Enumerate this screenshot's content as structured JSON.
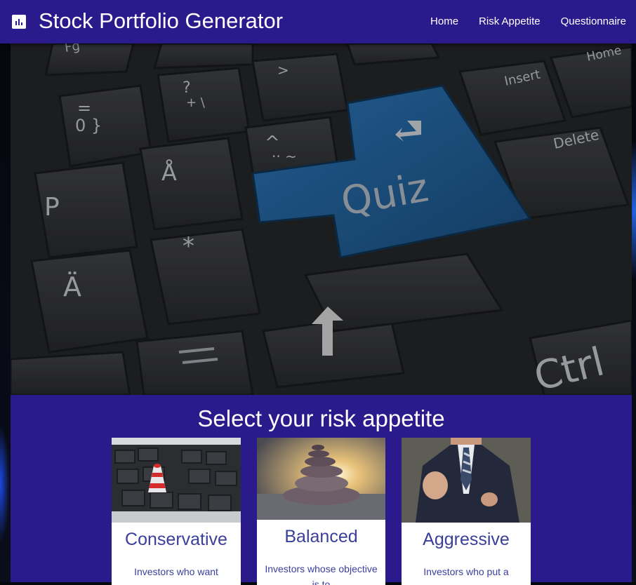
{
  "navbar": {
    "brand_icon": "bar-chart-icon",
    "title": "Stock Portfolio Generator",
    "links": [
      "Home",
      "Risk Appetite",
      "Questionnaire"
    ]
  },
  "hero": {
    "keys": [
      "Fg",
      "?",
      "+ \\",
      "=",
      "0 }",
      ">",
      "P",
      "Å",
      "^",
      "·· ~",
      "Quiz",
      "Insert",
      "Home",
      "Delete",
      "*",
      "Ä",
      "Ctrl"
    ]
  },
  "section": {
    "title": "Select your risk appetite"
  },
  "cards": [
    {
      "title": "Conservative",
      "desc": "Investors who want"
    },
    {
      "title": "Balanced",
      "desc": "Investors whose objective is to"
    },
    {
      "title": "Aggressive",
      "desc": "Investors who put a"
    }
  ],
  "colors": {
    "navbar": "#2a1a8c",
    "card_text": "#3a3f9a",
    "quiz_key": "#1f5f99"
  }
}
